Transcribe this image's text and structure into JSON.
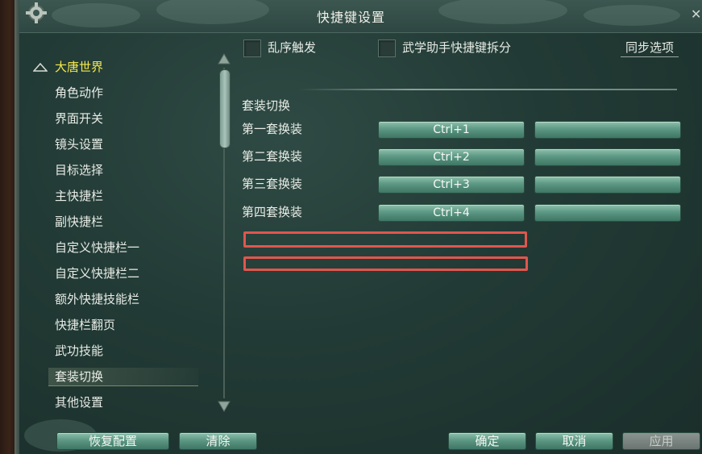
{
  "window": {
    "title": "快捷键设置"
  },
  "sidebar": {
    "group": "大唐世界",
    "items": [
      "角色动作",
      "界面开关",
      "镜头设置",
      "目标选择",
      "主快捷栏",
      "副快捷栏",
      "自定义快捷栏一",
      "自定义快捷栏二",
      "额外快捷技能栏",
      "快捷栏翻页",
      "武功技能",
      "套装切换",
      "其他设置"
    ],
    "selected": "套装切换"
  },
  "options": {
    "random_trigger": "乱序触发",
    "martial_split": "武学助手快捷键拆分",
    "sync": "同步选项"
  },
  "section": {
    "title": "套装切换",
    "rows": [
      {
        "label": "第一套换装",
        "key1": "Ctrl+1",
        "key2": ""
      },
      {
        "label": "第二套换装",
        "key1": "Ctrl+2",
        "key2": ""
      },
      {
        "label": "第三套换装",
        "key1": "Ctrl+3",
        "key2": ""
      },
      {
        "label": "第四套换装",
        "key1": "Ctrl+4",
        "key2": ""
      }
    ]
  },
  "footer": {
    "restore": "恢复配置",
    "clear": "清除",
    "ok": "确定",
    "cancel": "取消",
    "apply": "应用"
  },
  "colors": {
    "accent_group": "#f4e84a",
    "highlight_box": "#e0564e",
    "button_green": "#5c9884"
  }
}
